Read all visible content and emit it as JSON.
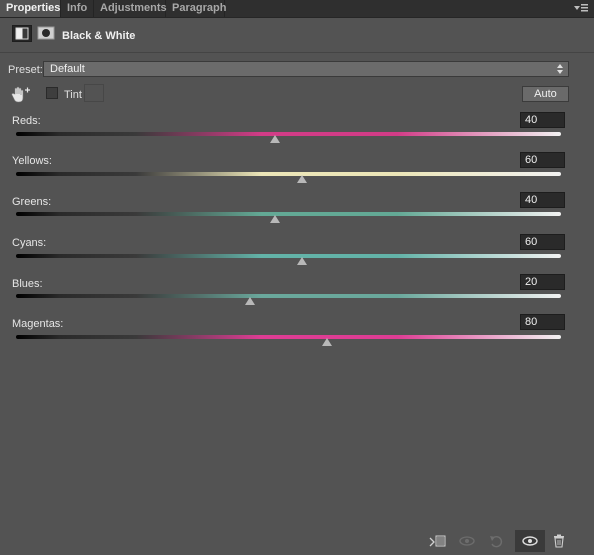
{
  "tabs": [
    {
      "label": "Properties",
      "active": true
    },
    {
      "label": "Info",
      "active": false
    },
    {
      "label": "Adjustments",
      "active": false
    },
    {
      "label": "Paragraph",
      "active": false
    }
  ],
  "header": {
    "title": "Black & White",
    "icons": [
      "adjustment-layer-icon",
      "layer-mask-icon"
    ]
  },
  "preset": {
    "label": "Preset:",
    "value": "Default"
  },
  "tools": {
    "tint_label": "Tint",
    "tint_checked": false,
    "auto_label": "Auto"
  },
  "sliders": [
    {
      "label": "Reds:",
      "value": "40",
      "level": 0.476,
      "color": "#d23c87"
    },
    {
      "label": "Yellows:",
      "value": "60",
      "level": 0.524,
      "color": "#ece6b8"
    },
    {
      "label": "Greens:",
      "value": "40",
      "level": 0.476,
      "color": "#63a995"
    },
    {
      "label": "Cyans:",
      "value": "60",
      "level": 0.524,
      "color": "#63b3a8"
    },
    {
      "label": "Blues:",
      "value": "20",
      "level": 0.429,
      "color": "#6aa89c"
    },
    {
      "label": "Magentas:",
      "value": "80",
      "level": 0.571,
      "color": "#de3d94"
    }
  ],
  "bottombar": {
    "icons": [
      "clip-to-layer-icon",
      "view-previous-state-icon",
      "reset-icon",
      "visibility-eye-icon",
      "trash-icon"
    ]
  },
  "colors": {
    "panel_bg": "#535353",
    "tabbar_bg": "#2f2f2f",
    "field_bg": "#2a2a2a",
    "button_bg": "#6a6a6a"
  }
}
